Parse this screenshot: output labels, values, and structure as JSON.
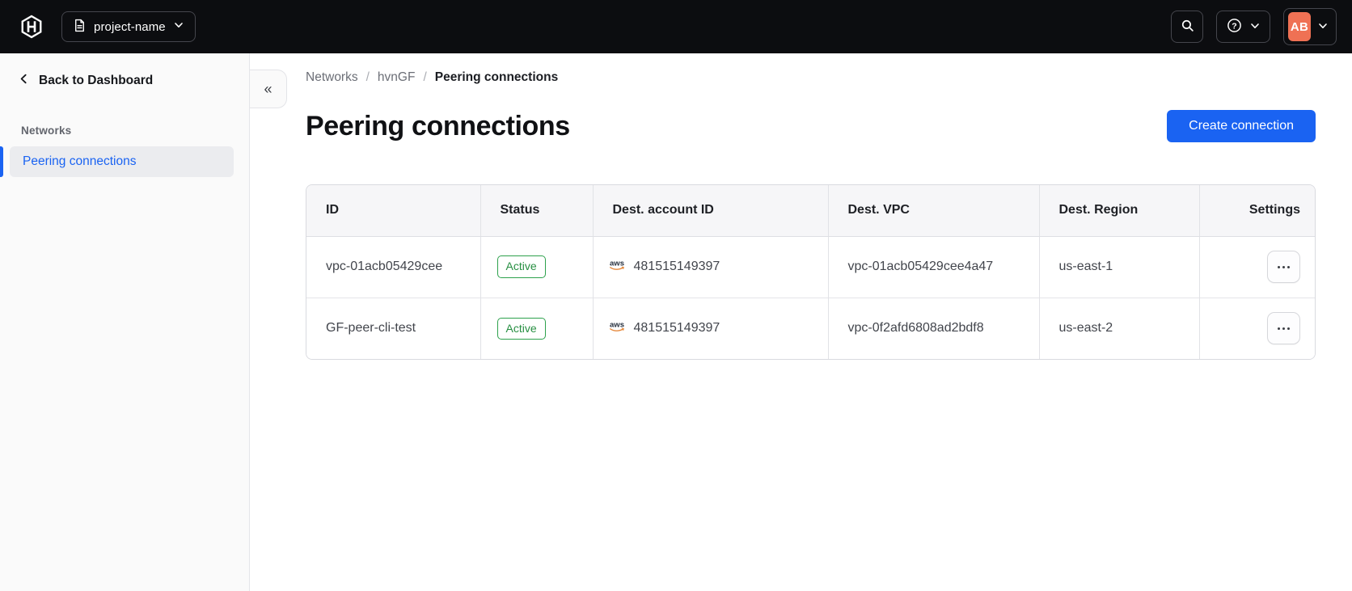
{
  "topbar": {
    "project_selector": {
      "label": "project-name",
      "icon": "document-icon"
    },
    "search": {
      "icon": "search-icon"
    },
    "help": {
      "icon": "help-icon"
    },
    "account": {
      "avatar_initials": "AB"
    },
    "logo_icon": "hashicorp-logo"
  },
  "sidebar": {
    "back_label": "Back to Dashboard",
    "back_icon": "chevron-left-icon",
    "section_label": "Networks",
    "items": [
      {
        "label": "Peering connections",
        "active": true
      }
    ],
    "collapse": {
      "icon": "collapse-double-chevron-icon",
      "glyph": "«"
    }
  },
  "breadcrumb": {
    "items": [
      "Networks",
      "hvnGF",
      "Peering connections"
    ],
    "separator": "/"
  },
  "page": {
    "title": "Peering connections",
    "create_button": "Create connection"
  },
  "table": {
    "columns": [
      "ID",
      "Status",
      "Dest. account ID",
      "Dest. VPC",
      "Dest. Region",
      "Settings"
    ],
    "rows": [
      {
        "id": "vpc-01acb05429cee",
        "status": "Active",
        "provider_icon": "aws-icon",
        "account_id": "481515149397",
        "vpc": "vpc-01acb05429cee4a47",
        "region": "us-east-1",
        "settings_icon": "ellipsis-icon"
      },
      {
        "id": "GF-peer-cli-test",
        "status": "Active",
        "provider_icon": "aws-icon",
        "account_id": "481515149397",
        "vpc": "vpc-0f2afd6808ad2bdf8",
        "region": "us-east-2",
        "settings_icon": "ellipsis-icon"
      }
    ]
  },
  "colors": {
    "topbar_bg": "#0C0D10",
    "accent_blue": "#1A63F2",
    "success_green": "#2DA14C",
    "avatar_orange": "#EF7154",
    "aws_orange": "#E68A3E",
    "sidebar_bg": "#FAFAFA"
  }
}
